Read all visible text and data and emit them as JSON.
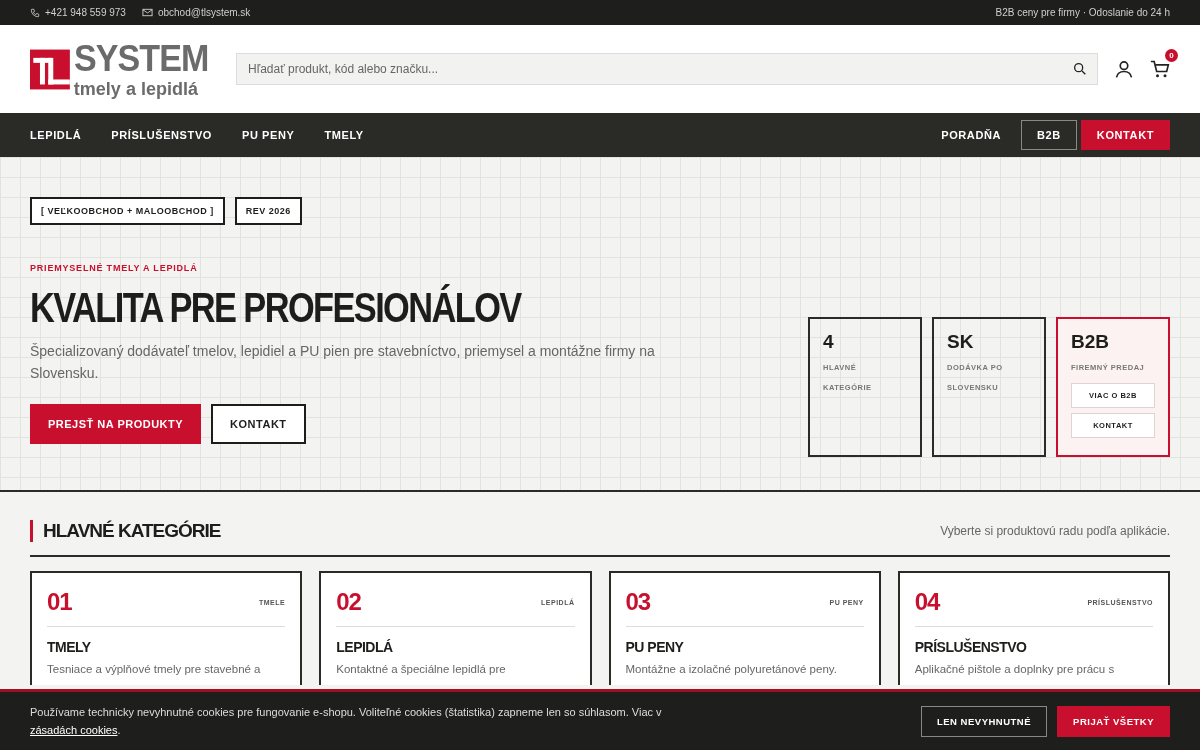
{
  "top_bar": {
    "phone": "+421 948 559 973",
    "email": "obchod@tlsystem.sk",
    "note": "B2B ceny pre firmy · Odoslanie do 24 h"
  },
  "header": {
    "logo": {
      "name": "SYSTEM",
      "tagline": "tmely a lepidlá"
    },
    "search": {
      "placeholder": "Hľadať produkt, kód alebo značku..."
    },
    "cart_count": "0"
  },
  "nav": {
    "items": [
      "LEPIDLÁ",
      "PRÍSLUŠENSTVO",
      "PU PENY",
      "TMELY"
    ],
    "links": [
      {
        "label": "PORADŇA",
        "kind": "link"
      },
      {
        "label": "B2B",
        "kind": "outline"
      },
      {
        "label": "KONTAKT",
        "kind": "primary"
      }
    ]
  },
  "hero": {
    "tags": [
      "[ VEĽKOOBCHOD + MALOOBCHOD ]",
      "REV 2026"
    ],
    "eyebrow": "PRIEMYSELNÉ TMELY A LEPIDLÁ",
    "title": "KVALITA PRE PROFESIONÁLOV",
    "lead": "Špecializovaný dodávateľ tmelov, lepidiel a PU pien pre stavebníctvo, priemysel a montážne firmy na Slovensku.",
    "buttons": [
      {
        "label": "PREJSŤ NA PRODUKTY",
        "kind": "primary"
      },
      {
        "label": "KONTAKT",
        "kind": "outline"
      }
    ],
    "stats": [
      {
        "value": "4",
        "label": "HLAVNÉ KATEGÓRIE",
        "kind": "plain"
      },
      {
        "value": "SK",
        "label": "DODÁVKA PO SLOVENSKU",
        "kind": "plain"
      },
      {
        "value": "B2B",
        "label": "FIREMNÝ PREDAJ",
        "kind": "highlight",
        "buttons": [
          "VIAC O B2B",
          "KONTAKT"
        ]
      }
    ]
  },
  "categories": {
    "title": "HLAVNÉ KATEGÓRIE",
    "subtitle": "Vyberte si produktovú radu podľa aplikácie.",
    "items": [
      {
        "number": "01",
        "tag": "TMELE",
        "title": "TMELY",
        "description": "Tesniace a výplňové tmely pre stavebné a"
      },
      {
        "number": "02",
        "tag": "LEPIDLÁ",
        "title": "LEPIDLÁ",
        "description": "Kontaktné a špeciálne lepidlá pre"
      },
      {
        "number": "03",
        "tag": "PU PENY",
        "title": "PU PENY",
        "description": "Montážne a izolačné polyuretánové peny."
      },
      {
        "number": "04",
        "tag": "PRÍSLUŠENSTVO",
        "title": "PRÍSLUŠENSTVO",
        "description": "Aplikačné pištole a doplnky pre prácu s"
      }
    ]
  },
  "cookie_bar": {
    "text": "Používame technicky nevyhnutné cookies pre fungovanie e-shopu. Voliteľné cookies (štatistika) zapneme len so súhlasom. Viac v",
    "link": "zásadách cookies",
    "after": ".",
    "buttons": [
      {
        "label": "LEN NEVYHNUTNÉ",
        "kind": "outline"
      },
      {
        "label": "PRIJAŤ VŠETKY",
        "kind": "primary"
      }
    ]
  }
}
